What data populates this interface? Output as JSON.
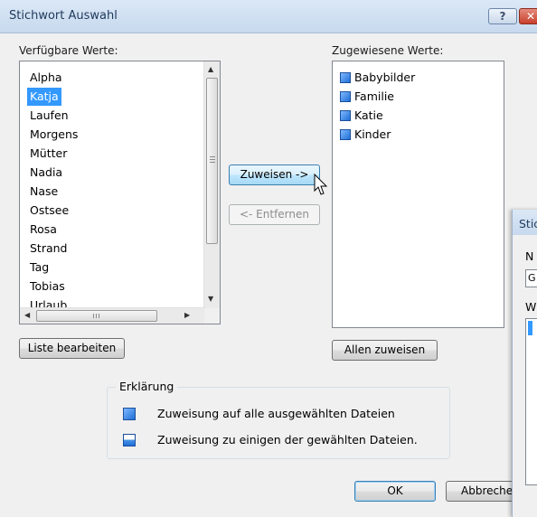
{
  "window": {
    "title": "Stichwort Auswahl",
    "help": "?",
    "close": "✕"
  },
  "available": {
    "label": "Verfügbare Werte:",
    "items": [
      "Alpha",
      "Katja",
      "Laufen",
      "Morgens",
      "Mütter",
      "Nadia",
      "Nase",
      "Ostsee",
      "Rosa",
      "Strand",
      "Tag",
      "Tobias",
      "Urlaub"
    ],
    "selected_index": 1,
    "edit_button": "Liste bearbeiten"
  },
  "assigned": {
    "label": "Zugewiesene Werte:",
    "items": [
      "Babybilder",
      "Familie",
      "Katie",
      "Kinder"
    ],
    "assign_all_button": "Allen zuweisen"
  },
  "actions": {
    "assign": "Zuweisen ->",
    "remove": "<- Entfernen"
  },
  "legend": {
    "title": "Erklärung",
    "full": "Zuweisung auf alle ausgewählten Dateien",
    "partial": "Zuweisung zu einigen der gewählten Dateien."
  },
  "footer": {
    "ok": "OK",
    "cancel": "Abbrechen"
  },
  "second_window": {
    "title_fragment": "Stic",
    "label_n": "N",
    "field_text": "G",
    "label_w": "W"
  },
  "colors": {
    "selection": "#3399ff",
    "title_text": "#1e395b",
    "keyword_icon": "#1f6fd6"
  }
}
